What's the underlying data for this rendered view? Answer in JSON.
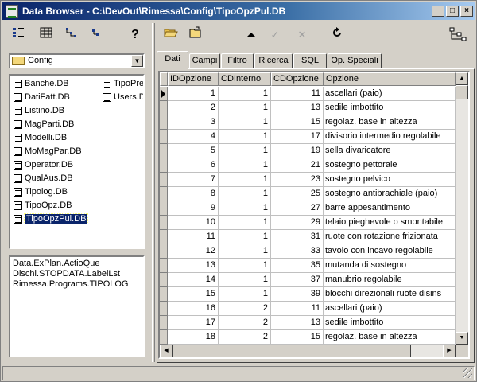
{
  "window": {
    "title": "Data Browser - C:\\DevOut\\Rimessa\\Config\\TipoOpzPul.DB"
  },
  "titlebar_buttons": {
    "minimize": "_",
    "maximize": "□",
    "close": "×"
  },
  "left_toolbar": [
    "large-icons-icon",
    "details-icon",
    "tree-icon",
    "small-icons-icon",
    "help-icon"
  ],
  "help_glyph": "?",
  "folder_combo": {
    "value": "Config"
  },
  "files": [
    {
      "name": "Banche.DB",
      "selected": false
    },
    {
      "name": "DatiFatt.DB",
      "selected": false
    },
    {
      "name": "Listino.DB",
      "selected": false
    },
    {
      "name": "MagParti.DB",
      "selected": false
    },
    {
      "name": "Modelli.DB",
      "selected": false
    },
    {
      "name": "MoMagPar.DB",
      "selected": false
    },
    {
      "name": "Operator.DB",
      "selected": false
    },
    {
      "name": "QualAus.DB",
      "selected": false
    },
    {
      "name": "Tipolog.DB",
      "selected": false
    },
    {
      "name": "TipoOpz.DB",
      "selected": false
    },
    {
      "name": "TipoOpzPul.DB",
      "selected": true
    },
    {
      "name": "TipoPres",
      "selected": false
    },
    {
      "name": "Users.DI",
      "selected": false
    }
  ],
  "references": [
    "Data.ExPlan.ActioQue",
    "Dischi.STOPDATA.LabelLst",
    "Rimessa.Programs.TIPOLOG"
  ],
  "tabs": [
    {
      "label": "Dati",
      "active": true
    },
    {
      "label": "Campi",
      "active": false
    },
    {
      "label": "Filtro",
      "active": false
    },
    {
      "label": "Ricerca",
      "active": false
    },
    {
      "label": "SQL",
      "active": false
    },
    {
      "label": "Op. Speciali",
      "active": false
    }
  ],
  "grid": {
    "columns": [
      "IDOpzione",
      "CDInterno",
      "CDOpzione",
      "Opzione"
    ],
    "rows": [
      [
        "1",
        "1",
        "11",
        "ascellari (paio)"
      ],
      [
        "2",
        "1",
        "13",
        "sedile imbottito"
      ],
      [
        "3",
        "1",
        "15",
        "regolaz. base in altezza"
      ],
      [
        "4",
        "1",
        "17",
        "divisorio intermedio regolabile"
      ],
      [
        "5",
        "1",
        "19",
        "sella divaricatore"
      ],
      [
        "6",
        "1",
        "21",
        "sostegno pettorale"
      ],
      [
        "7",
        "1",
        "23",
        "sostegno pelvico"
      ],
      [
        "8",
        "1",
        "25",
        "sostegno antibrachiale (paio)"
      ],
      [
        "9",
        "1",
        "27",
        "barre appesantimento"
      ],
      [
        "10",
        "1",
        "29",
        "telaio pieghevole o smontabile"
      ],
      [
        "11",
        "1",
        "31",
        "ruote con rotazione frizionata"
      ],
      [
        "12",
        "1",
        "33",
        "tavolo con incavo regolabile"
      ],
      [
        "13",
        "1",
        "35",
        "mutanda di sostegno"
      ],
      [
        "14",
        "1",
        "37",
        "manubrio regolabile"
      ],
      [
        "15",
        "1",
        "39",
        "blocchi direzionali ruote disins"
      ],
      [
        "16",
        "2",
        "11",
        "ascellari (paio)"
      ],
      [
        "17",
        "2",
        "13",
        "sedile imbottito"
      ],
      [
        "18",
        "2",
        "15",
        "regolaz. base in altezza"
      ]
    ],
    "current_row": 0
  }
}
